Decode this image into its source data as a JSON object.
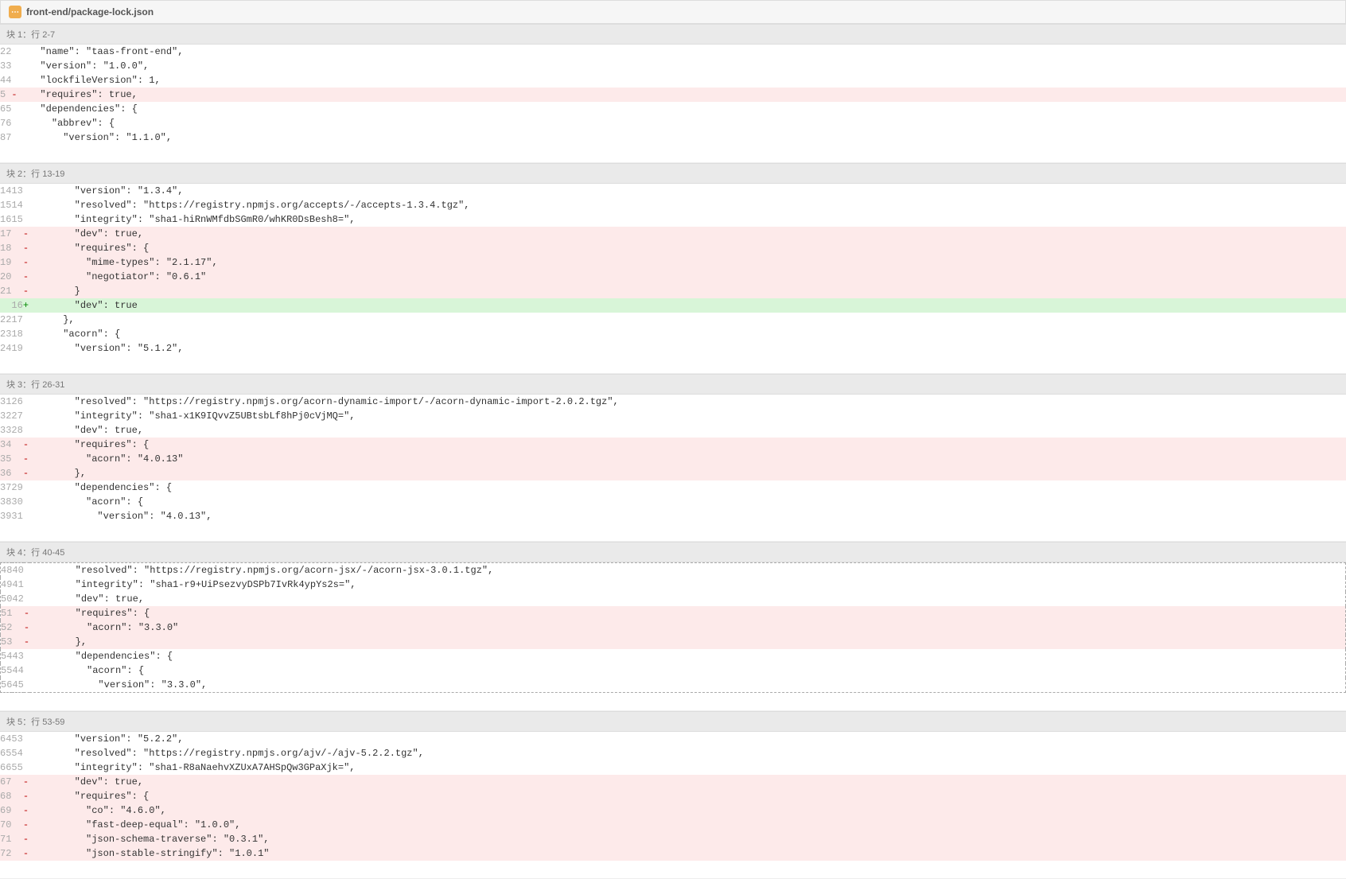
{
  "file": {
    "icon_glyph": "⋯",
    "name": "front-end/package-lock.json"
  },
  "hunks": [
    {
      "header": "块 1：行 2-7",
      "dotted": false,
      "rows": [
        {
          "o": "2",
          "n": "2",
          "s": " ",
          "t": "ctx",
          "c": "    \"name\": \"taas-front-end\","
        },
        {
          "o": "3",
          "n": "3",
          "s": " ",
          "t": "ctx",
          "c": "    \"version\": \"1.0.0\","
        },
        {
          "o": "4",
          "n": "4",
          "s": " ",
          "t": "ctx",
          "c": "    \"lockfileVersion\": 1,"
        },
        {
          "o": "5",
          "n": "",
          "s": "-",
          "t": "del",
          "c": "    \"requires\": true,"
        },
        {
          "o": "6",
          "n": "5",
          "s": " ",
          "t": "ctx",
          "c": "    \"dependencies\": {"
        },
        {
          "o": "7",
          "n": "6",
          "s": " ",
          "t": "ctx",
          "c": "      \"abbrev\": {"
        },
        {
          "o": "8",
          "n": "7",
          "s": " ",
          "t": "ctx",
          "c": "        \"version\": \"1.1.0\","
        }
      ]
    },
    {
      "header": "块 2：行 13-19",
      "dotted": false,
      "rows": [
        {
          "o": "14",
          "n": "13",
          "s": " ",
          "t": "ctx",
          "c": "        \"version\": \"1.3.4\","
        },
        {
          "o": "15",
          "n": "14",
          "s": " ",
          "t": "ctx",
          "c": "        \"resolved\": \"https://registry.npmjs.org/accepts/-/accepts-1.3.4.tgz\","
        },
        {
          "o": "16",
          "n": "15",
          "s": " ",
          "t": "ctx",
          "c": "        \"integrity\": \"sha1-hiRnWMfdbSGmR0/whKR0DsBesh8=\","
        },
        {
          "o": "17",
          "n": "",
          "s": "-",
          "t": "del",
          "c": "        \"dev\": true,"
        },
        {
          "o": "18",
          "n": "",
          "s": "-",
          "t": "del",
          "c": "        \"requires\": {"
        },
        {
          "o": "19",
          "n": "",
          "s": "-",
          "t": "del",
          "c": "          \"mime-types\": \"2.1.17\","
        },
        {
          "o": "20",
          "n": "",
          "s": "-",
          "t": "del",
          "c": "          \"negotiator\": \"0.6.1\""
        },
        {
          "o": "21",
          "n": "",
          "s": "-",
          "t": "del",
          "c": "        }"
        },
        {
          "o": "",
          "n": "16",
          "s": "+",
          "t": "add",
          "c": "        \"dev\": true"
        },
        {
          "o": "22",
          "n": "17",
          "s": " ",
          "t": "ctx",
          "c": "      },"
        },
        {
          "o": "23",
          "n": "18",
          "s": " ",
          "t": "ctx",
          "c": "      \"acorn\": {"
        },
        {
          "o": "24",
          "n": "19",
          "s": " ",
          "t": "ctx",
          "c": "        \"version\": \"5.1.2\","
        }
      ]
    },
    {
      "header": "块 3：行 26-31",
      "dotted": false,
      "rows": [
        {
          "o": "31",
          "n": "26",
          "s": " ",
          "t": "ctx",
          "c": "        \"resolved\": \"https://registry.npmjs.org/acorn-dynamic-import/-/acorn-dynamic-import-2.0.2.tgz\","
        },
        {
          "o": "32",
          "n": "27",
          "s": " ",
          "t": "ctx",
          "c": "        \"integrity\": \"sha1-x1K9IQvvZ5UBtsbLf8hPj0cVjMQ=\","
        },
        {
          "o": "33",
          "n": "28",
          "s": " ",
          "t": "ctx",
          "c": "        \"dev\": true,"
        },
        {
          "o": "34",
          "n": "",
          "s": "-",
          "t": "del",
          "c": "        \"requires\": {"
        },
        {
          "o": "35",
          "n": "",
          "s": "-",
          "t": "del",
          "c": "          \"acorn\": \"4.0.13\""
        },
        {
          "o": "36",
          "n": "",
          "s": "-",
          "t": "del",
          "c": "        },"
        },
        {
          "o": "37",
          "n": "29",
          "s": " ",
          "t": "ctx",
          "c": "        \"dependencies\": {"
        },
        {
          "o": "38",
          "n": "30",
          "s": " ",
          "t": "ctx",
          "c": "          \"acorn\": {"
        },
        {
          "o": "39",
          "n": "31",
          "s": " ",
          "t": "ctx",
          "c": "            \"version\": \"4.0.13\","
        }
      ]
    },
    {
      "header": "块 4：行 40-45",
      "dotted": true,
      "rows": [
        {
          "o": "48",
          "n": "40",
          "s": " ",
          "t": "ctx",
          "c": "        \"resolved\": \"https://registry.npmjs.org/acorn-jsx/-/acorn-jsx-3.0.1.tgz\","
        },
        {
          "o": "49",
          "n": "41",
          "s": " ",
          "t": "ctx",
          "c": "        \"integrity\": \"sha1-r9+UiPsezvyDSPb7IvRk4ypYs2s=\","
        },
        {
          "o": "50",
          "n": "42",
          "s": " ",
          "t": "ctx",
          "c": "        \"dev\": true,"
        },
        {
          "o": "51",
          "n": "",
          "s": "-",
          "t": "del",
          "c": "        \"requires\": {"
        },
        {
          "o": "52",
          "n": "",
          "s": "-",
          "t": "del",
          "c": "          \"acorn\": \"3.3.0\""
        },
        {
          "o": "53",
          "n": "",
          "s": "-",
          "t": "del",
          "c": "        },"
        },
        {
          "o": "54",
          "n": "43",
          "s": " ",
          "t": "ctx",
          "c": "        \"dependencies\": {"
        },
        {
          "o": "55",
          "n": "44",
          "s": " ",
          "t": "ctx",
          "c": "          \"acorn\": {"
        },
        {
          "o": "56",
          "n": "45",
          "s": " ",
          "t": "ctx",
          "c": "            \"version\": \"3.3.0\","
        }
      ]
    },
    {
      "header": "块 5：行 53-59",
      "dotted": false,
      "rows": [
        {
          "o": "64",
          "n": "53",
          "s": " ",
          "t": "ctx",
          "c": "        \"version\": \"5.2.2\","
        },
        {
          "o": "65",
          "n": "54",
          "s": " ",
          "t": "ctx",
          "c": "        \"resolved\": \"https://registry.npmjs.org/ajv/-/ajv-5.2.2.tgz\","
        },
        {
          "o": "66",
          "n": "55",
          "s": " ",
          "t": "ctx",
          "c": "        \"integrity\": \"sha1-R8aNaehvXZUxA7AHSpQw3GPaXjk=\","
        },
        {
          "o": "67",
          "n": "",
          "s": "-",
          "t": "del",
          "c": "        \"dev\": true,"
        },
        {
          "o": "68",
          "n": "",
          "s": "-",
          "t": "del",
          "c": "        \"requires\": {"
        },
        {
          "o": "69",
          "n": "",
          "s": "-",
          "t": "del",
          "c": "          \"co\": \"4.6.0\","
        },
        {
          "o": "70",
          "n": "",
          "s": "-",
          "t": "del",
          "c": "          \"fast-deep-equal\": \"1.0.0\","
        },
        {
          "o": "71",
          "n": "",
          "s": "-",
          "t": "del",
          "c": "          \"json-schema-traverse\": \"0.3.1\","
        },
        {
          "o": "72",
          "n": "",
          "s": "-",
          "t": "del",
          "c": "          \"json-stable-stringify\": \"1.0.1\""
        }
      ]
    }
  ]
}
